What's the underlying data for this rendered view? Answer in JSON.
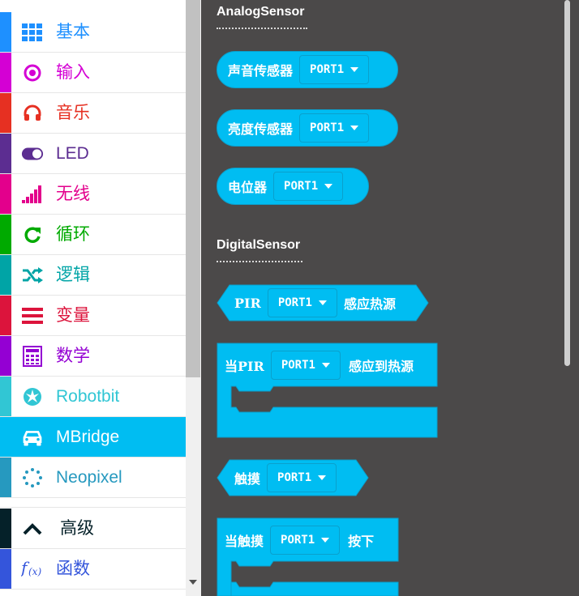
{
  "categories": [
    {
      "label": "基本",
      "color": "#1e90ff",
      "icon": "grid-icon"
    },
    {
      "label": "输入",
      "color": "#d400d4",
      "icon": "target-icon"
    },
    {
      "label": "音乐",
      "color": "#e63022",
      "icon": "headphones-icon"
    },
    {
      "label": "LED",
      "color": "#5c2d91",
      "icon": "toggle-icon"
    },
    {
      "label": "无线",
      "color": "#e3008c",
      "icon": "signal-bars-icon"
    },
    {
      "label": "循环",
      "color": "#00aa00",
      "icon": "refresh-icon"
    },
    {
      "label": "逻辑",
      "color": "#00a4a6",
      "icon": "shuffle-icon"
    },
    {
      "label": "变量",
      "color": "#dc143c",
      "icon": "list-icon"
    },
    {
      "label": "数学",
      "color": "#9400d3",
      "icon": "calculator-icon"
    },
    {
      "label": "Robotbit",
      "color": "#31c6d4",
      "icon": "rebel-icon"
    },
    {
      "label": "MBridge",
      "color": "#00bdf2",
      "icon": "car-icon"
    },
    {
      "label": "Neopixel",
      "color": "#2699bf",
      "icon": "dotted-circle-icon"
    }
  ],
  "advanced": {
    "label": "高级",
    "color": "#052129",
    "icon": "chevron-up-icon"
  },
  "functions": {
    "label": "函数",
    "color": "#3455db",
    "icon": "function-icon"
  },
  "selected_category": "MBridge",
  "flyout": {
    "analog_title": "AnalogSensor",
    "digital_title": "DigitalSensor",
    "sound_label": "声音传感器",
    "light_label": "亮度传感器",
    "pot_label": "电位器",
    "pir_label": "PIR",
    "pir_suffix": "感应热源",
    "when_pir_label": "当PIR",
    "when_pir_suffix": "感应到热源",
    "touch_label": "触摸",
    "when_touch_label": "当触摸",
    "when_touch_suffix": "按下",
    "port_value": "PORT1"
  },
  "colors": {
    "block": "#00bdf2",
    "flyout_bg": "#4b4949"
  }
}
